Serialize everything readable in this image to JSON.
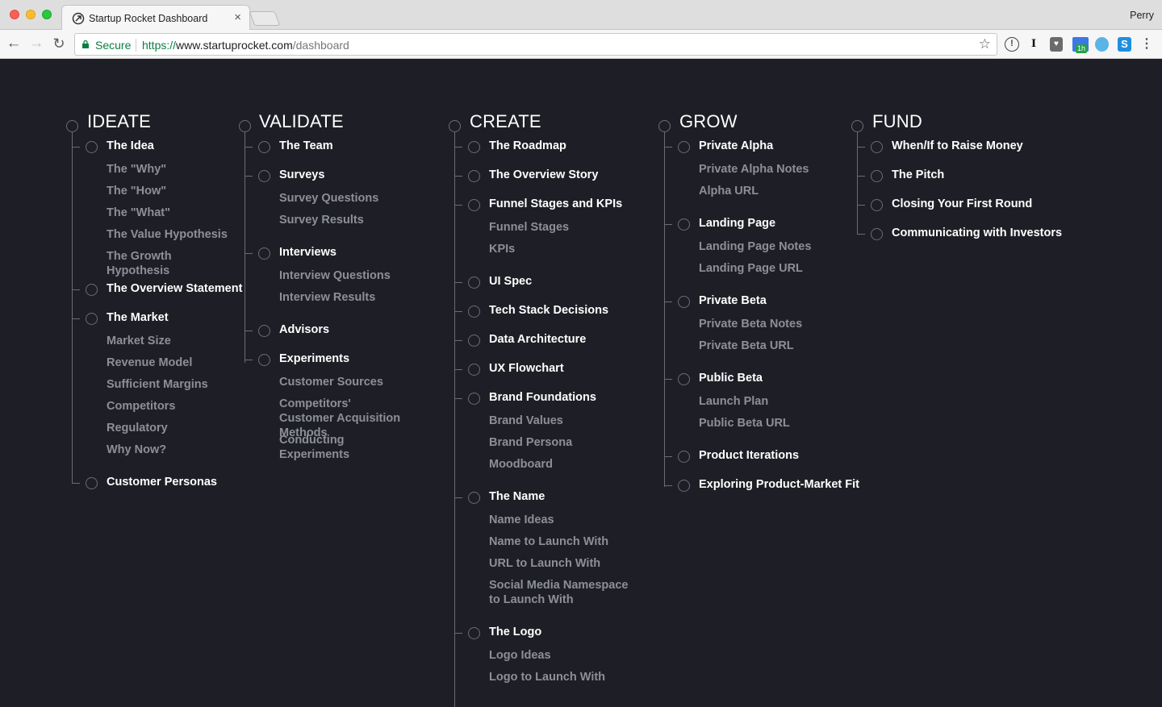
{
  "browser": {
    "tab_title": "Startup Rocket Dashboard",
    "profile_name": "Perry",
    "secure_label": "Secure",
    "url_scheme": "https://",
    "url_host": "www.startuprocket.com",
    "url_path": "/dashboard",
    "extension_badge": "1h"
  },
  "colors": {
    "background": "#1e1f26",
    "primary_text": "#ffffff",
    "secondary_text": "#8d8f98",
    "line": "#6a6c75",
    "secure_green": "#0b8043"
  },
  "roadmap": {
    "ideate": {
      "title": "IDEATE",
      "items": [
        {
          "label": "The Idea",
          "subs": [
            "The \"Why\"",
            "The \"How\"",
            "The \"What\"",
            "The Value Hypothesis",
            "The Growth Hypothesis"
          ]
        },
        {
          "label": "The Overview Statement",
          "subs": []
        },
        {
          "label": "The Market",
          "subs": [
            "Market Size",
            "Revenue Model",
            "Sufficient Margins",
            "Competitors",
            "Regulatory",
            "Why Now?"
          ]
        },
        {
          "label": "Customer Personas",
          "subs": []
        }
      ]
    },
    "validate": {
      "title": "VALIDATE",
      "items": [
        {
          "label": "The Team",
          "subs": []
        },
        {
          "label": "Surveys",
          "subs": [
            "Survey Questions",
            "Survey Results"
          ]
        },
        {
          "label": "Interviews",
          "subs": [
            "Interview Questions",
            "Interview Results"
          ]
        },
        {
          "label": "Advisors",
          "subs": []
        },
        {
          "label": "Experiments",
          "subs": [
            "Customer Sources",
            "Competitors' Customer Acquisition Methods",
            "Conducting Experiments"
          ]
        }
      ]
    },
    "create": {
      "title": "CREATE",
      "items": [
        {
          "label": "The Roadmap",
          "subs": []
        },
        {
          "label": "The Overview Story",
          "subs": []
        },
        {
          "label": "Funnel Stages and KPIs",
          "subs": [
            "Funnel Stages",
            "KPIs"
          ]
        },
        {
          "label": "UI Spec",
          "subs": []
        },
        {
          "label": "Tech Stack Decisions",
          "subs": []
        },
        {
          "label": "Data Architecture",
          "subs": []
        },
        {
          "label": "UX Flowchart",
          "subs": []
        },
        {
          "label": "Brand Foundations",
          "subs": [
            "Brand Values",
            "Brand Persona",
            "Moodboard"
          ]
        },
        {
          "label": "The Name",
          "subs": [
            "Name Ideas",
            "Name to Launch With",
            "URL to Launch With",
            "Social Media Namespace to Launch With"
          ]
        },
        {
          "label": "The Logo",
          "subs": [
            "Logo Ideas",
            "Logo to Launch With"
          ]
        }
      ]
    },
    "grow": {
      "title": "GROW",
      "items": [
        {
          "label": "Private Alpha",
          "subs": [
            "Private Alpha Notes",
            "Alpha URL"
          ]
        },
        {
          "label": "Landing Page",
          "subs": [
            "Landing Page Notes",
            "Landing Page URL"
          ]
        },
        {
          "label": "Private Beta",
          "subs": [
            "Private Beta Notes",
            "Private Beta URL"
          ]
        },
        {
          "label": "Public Beta",
          "subs": [
            "Launch Plan",
            "Public Beta URL"
          ]
        },
        {
          "label": "Product Iterations",
          "subs": []
        },
        {
          "label": "Exploring Product-Market Fit",
          "subs": []
        }
      ]
    },
    "fund": {
      "title": "FUND",
      "items": [
        {
          "label": "When/If to Raise Money",
          "subs": []
        },
        {
          "label": "The Pitch",
          "subs": []
        },
        {
          "label": "Closing Your First Round",
          "subs": []
        },
        {
          "label": "Communicating with Investors",
          "subs": []
        }
      ]
    }
  }
}
